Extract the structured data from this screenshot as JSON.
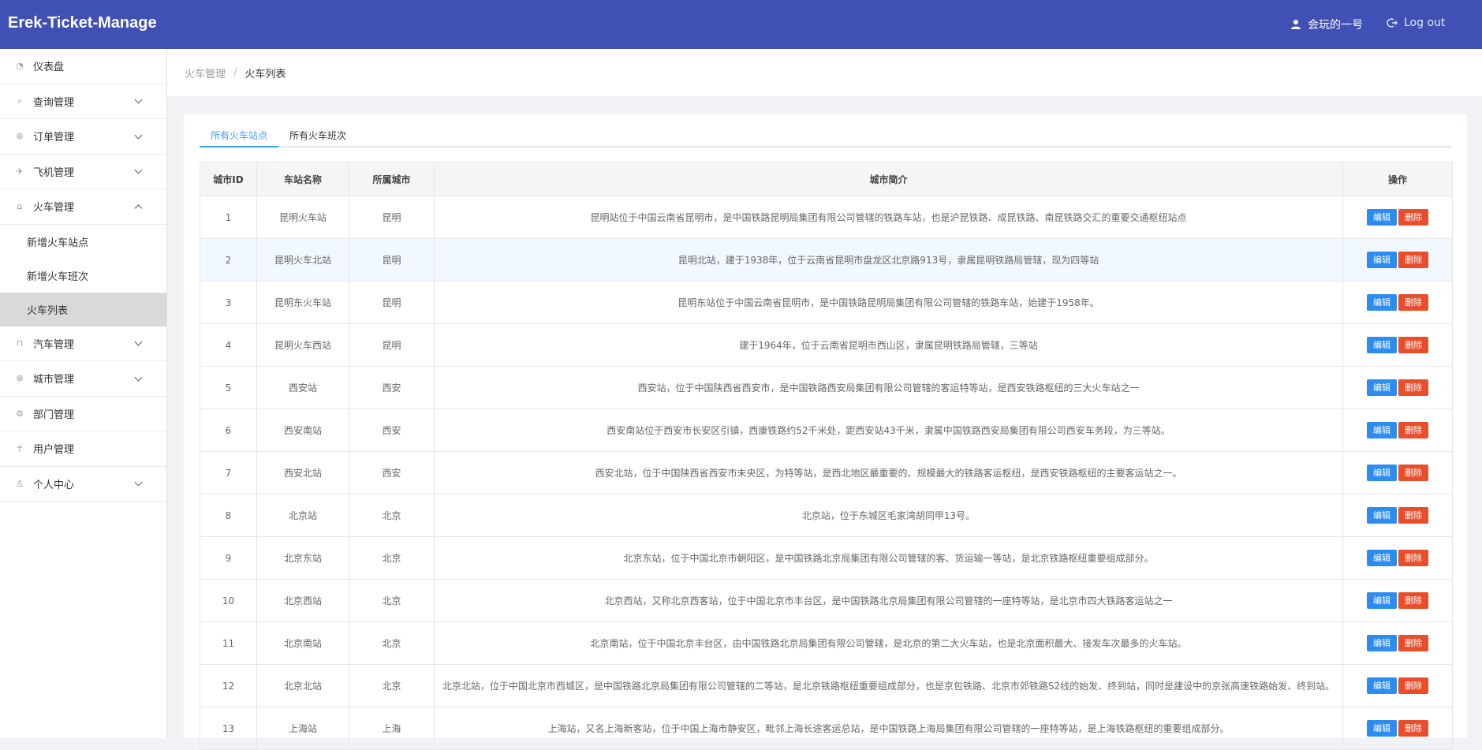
{
  "header": {
    "logo": "Erek-Ticket-Manage",
    "user_name": "会玩的一号",
    "logout_label": "Log out"
  },
  "sidebar": {
    "items": [
      {
        "label": "仪表盘",
        "icon": "dashboard-icon",
        "expandable": false
      },
      {
        "label": "查询管理",
        "icon": "search-icon",
        "expandable": true
      },
      {
        "label": "订单管理",
        "icon": "order-icon",
        "expandable": true
      },
      {
        "label": "飞机管理",
        "icon": "plane-icon",
        "expandable": true
      },
      {
        "label": "火车管理",
        "icon": "train-icon",
        "expandable": true,
        "open": true,
        "children": [
          {
            "label": "新增火车站点",
            "active": false
          },
          {
            "label": "新增火车班次",
            "active": false
          },
          {
            "label": "火车列表",
            "active": true
          }
        ]
      },
      {
        "label": "汽车管理",
        "icon": "car-icon",
        "expandable": true
      },
      {
        "label": "城市管理",
        "icon": "city-icon",
        "expandable": true
      },
      {
        "label": "部门管理",
        "icon": "department-icon",
        "expandable": false
      },
      {
        "label": "用户管理",
        "icon": "user-admin-icon",
        "expandable": false
      },
      {
        "label": "个人中心",
        "icon": "profile-icon",
        "expandable": true
      }
    ]
  },
  "breadcrumb": {
    "parent": "火车管理",
    "current": "火车列表",
    "separator": "/"
  },
  "tabs": [
    {
      "label": "所有火车站点",
      "active": true
    },
    {
      "label": "所有火车班次",
      "active": false
    }
  ],
  "table": {
    "headers": [
      "城市ID",
      "车站名称",
      "所属城市",
      "城市简介",
      "操作"
    ],
    "edit_label": "编辑",
    "delete_label": "删除",
    "rows": [
      {
        "id": "1",
        "name": "昆明火车站",
        "city": "昆明",
        "desc": "昆明站位于中国云南省昆明市，是中国铁路昆明局集团有限公司管辖的铁路车站，也是沪昆铁路、成昆铁路、南昆铁路交汇的重要交通枢纽站点"
      },
      {
        "id": "2",
        "name": "昆明火车北站",
        "city": "昆明",
        "desc": "昆明北站，建于1938年，位于云南省昆明市盘龙区北京路913号，隶属昆明铁路局管辖，现为四等站"
      },
      {
        "id": "3",
        "name": "昆明东火车站",
        "city": "昆明",
        "desc": "昆明东站位于中国云南省昆明市，是中国铁路昆明局集团有限公司管辖的铁路车站，始建于1958年。"
      },
      {
        "id": "4",
        "name": "昆明火车西站",
        "city": "昆明",
        "desc": "建于1964年，位于云南省昆明市西山区，隶属昆明铁路局管辖，三等站"
      },
      {
        "id": "5",
        "name": "西安站",
        "city": "西安",
        "desc": "西安站，位于中国陕西省西安市，是中国铁路西安局集团有限公司管辖的客运特等站，是西安铁路枢纽的三大火车站之一"
      },
      {
        "id": "6",
        "name": "西安南站",
        "city": "西安",
        "desc": "西安南站位于西安市长安区引镇，西康铁路约52千米处，距西安站43千米，隶属中国铁路西安局集团有限公司西安车务段，为三等站。"
      },
      {
        "id": "7",
        "name": "西安北站",
        "city": "西安",
        "desc": "西安北站，位于中国陕西省西安市未央区，为特等站，是西北地区最重要的、规模最大的铁路客运枢纽，是西安铁路枢纽的主要客运站之一。"
      },
      {
        "id": "8",
        "name": "北京站",
        "city": "北京",
        "desc": "北京站，位于东城区毛家湾胡同甲13号。"
      },
      {
        "id": "9",
        "name": "北京东站",
        "city": "北京",
        "desc": "北京东站，位于中国北京市朝阳区，是中国铁路北京局集团有限公司管辖的客、货运输一等站，是北京铁路枢纽重要组成部分。"
      },
      {
        "id": "10",
        "name": "北京西站",
        "city": "北京",
        "desc": "北京西站，又称北京西客站，位于中国北京市丰台区，是中国铁路北京局集团有限公司管辖的一座特等站，是北京市四大铁路客运站之一"
      },
      {
        "id": "11",
        "name": "北京南站",
        "city": "北京",
        "desc": "北京南站，位于中国北京丰台区，由中国铁路北京局集团有限公司管辖，是北京的第二大火车站，也是北京面积最大、接发车次最多的火车站。"
      },
      {
        "id": "12",
        "name": "北京北站",
        "city": "北京",
        "desc": "北京北站，位于中国北京市西城区，是中国铁路北京局集团有限公司管辖的二等站，是北京铁路枢纽重要组成部分，也是京包铁路、北京市郊铁路S2线的始发、终到站，同时是建设中的京张高速铁路始发、终到站。"
      },
      {
        "id": "13",
        "name": "上海站",
        "city": "上海",
        "desc": "上海站，又名上海新客站，位于中国上海市静安区，毗邻上海长途客运总站，是中国铁路上海局集团有限公司管辖的一座特等站，是上海铁路枢纽的重要组成部分。"
      }
    ]
  },
  "colors": {
    "header_bg": "#4050b5",
    "tab_active": "#409eff",
    "edit_btn": "#2d8cf0",
    "delete_btn": "#e84e2c"
  }
}
